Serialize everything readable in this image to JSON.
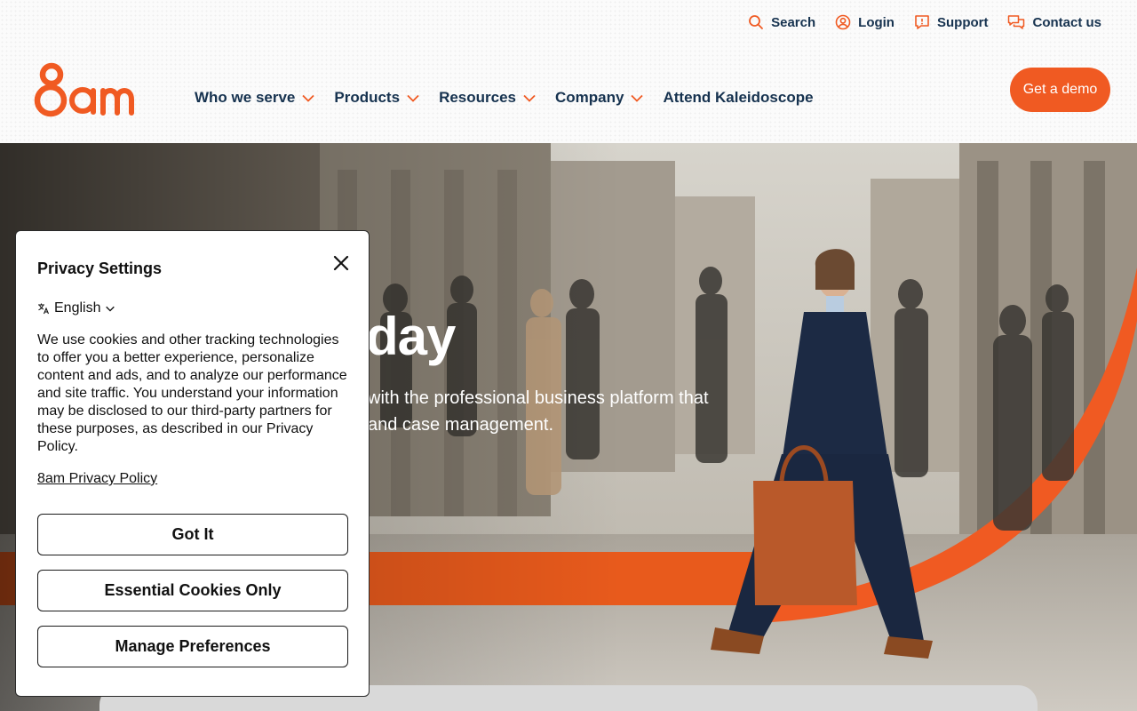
{
  "brand": {
    "logo_text": "8am",
    "accent": "#f05a22",
    "navy": "#16324f"
  },
  "utility_nav": [
    {
      "label": "Search",
      "icon": "search-icon"
    },
    {
      "label": "Login",
      "icon": "user-circle-icon"
    },
    {
      "label": "Support",
      "icon": "help-chat-icon"
    },
    {
      "label": "Contact us",
      "icon": "chat-bubbles-icon"
    }
  ],
  "main_nav": [
    {
      "label": "Who we serve",
      "has_dropdown": true
    },
    {
      "label": "Products",
      "has_dropdown": true
    },
    {
      "label": "Resources",
      "has_dropdown": true
    },
    {
      "label": "Company",
      "has_dropdown": true
    },
    {
      "label": "Attend Kaleidoscope",
      "has_dropdown": false
    }
  ],
  "cta": {
    "demo_label": "Get a demo"
  },
  "hero": {
    "title_visible": "day",
    "subtitle_line1": "with the professional business platform that",
    "subtitle_line2": "and case management."
  },
  "privacy_modal": {
    "title": "Privacy Settings",
    "language": "English",
    "body": "We use cookies and other tracking technologies to offer you a better experience, personalize content and ads, and to analyze our performance and site traffic.  You understand your information may be disclosed to our third-party partners for these purposes, as described in our Privacy Policy.",
    "policy_link": "8am Privacy Policy",
    "buttons": {
      "accept": "Got It",
      "essential": "Essential Cookies Only",
      "manage": "Manage Preferences"
    }
  }
}
